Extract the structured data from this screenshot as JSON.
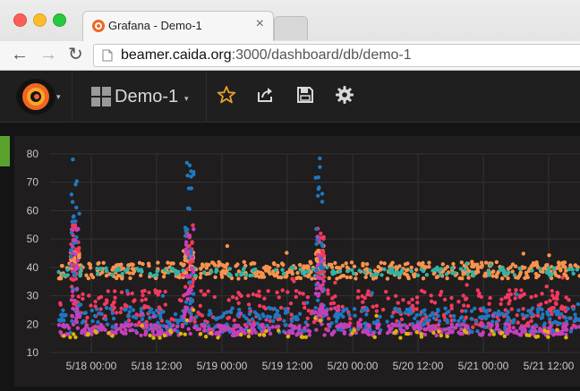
{
  "browser": {
    "tab_title": "Grafana - Demo-1",
    "tab_close": "×",
    "url_host": "beamer.caida.org",
    "url_path": ":3000/dashboard/db/demo-1",
    "nav_back": "←",
    "nav_forward": "→",
    "nav_reload": "↻"
  },
  "grafana": {
    "dashboard_title": "Demo-1",
    "dropdown_caret": "▾",
    "icons": [
      "grafana-logo-icon",
      "star-icon",
      "share-icon",
      "save-icon",
      "gear-icon"
    ]
  },
  "colors": {
    "star": "#e8a02a",
    "row_accent": "#5ba12e",
    "series": [
      "#f9934e",
      "#2fb4a6",
      "#f2395e",
      "#1f78c1",
      "#c440ba",
      "#e0b400"
    ]
  },
  "chart_data": {
    "type": "scatter",
    "title": "",
    "xlabel": "",
    "ylabel": "",
    "ylim": [
      10,
      80
    ],
    "y_ticks": [
      "10",
      "20",
      "30",
      "40",
      "50",
      "60",
      "70",
      "80"
    ],
    "x_ticks": [
      "5/18 00:00",
      "5/18 12:00",
      "5/19 00:00",
      "5/19 12:00",
      "5/20 00:00",
      "5/20 12:00",
      "5/21 00:00",
      "5/21 12:00"
    ],
    "x_range": [
      "5/17 18:00",
      "5/21 12:40"
    ],
    "grid": true,
    "series": [
      {
        "color": "#f9934e",
        "typical_range": [
          36,
          42
        ],
        "spikes_at": [
          "5/17 21:00",
          "5/18 18:00",
          "5/19 18:00"
        ],
        "spike_peak": 46
      },
      {
        "color": "#2fb4a6",
        "typical_range": [
          37,
          40
        ]
      },
      {
        "color": "#f2395e",
        "typical_range": [
          18,
          32
        ],
        "spikes_at": [
          "5/17 21:00",
          "5/18 18:00",
          "5/19 18:00"
        ],
        "spike_peak": 55
      },
      {
        "color": "#1f78c1",
        "typical_range": [
          17,
          26
        ],
        "spikes_at": [
          "5/17 21:00",
          "5/18 18:00",
          "5/19 18:00"
        ],
        "spike_peak": 79
      },
      {
        "color": "#c440ba",
        "typical_range": [
          16,
          20
        ],
        "spikes_at": [
          "5/17 21:00",
          "5/18 18:00",
          "5/19 18:00"
        ],
        "spike_peak": 54
      },
      {
        "color": "#e0b400",
        "typical_range": [
          15,
          18
        ]
      }
    ]
  }
}
